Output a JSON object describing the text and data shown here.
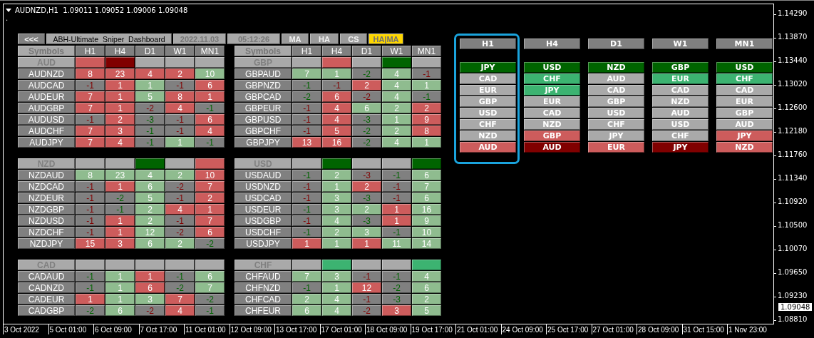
{
  "chart": {
    "title": "AUDNZD,H1  1.09011 1.09052 1.09006 1.09048",
    "subtitle": "."
  },
  "toolbar": {
    "back": "<<<",
    "title": "ABH-Ultimate  Sniper  Dashboard",
    "date": "2022.11.03",
    "time": "05:12:26",
    "tabs": [
      {
        "label": "MA",
        "selected": false
      },
      {
        "label": "HA",
        "selected": false
      },
      {
        "label": "CS",
        "selected": false
      },
      {
        "label": "HA|MA",
        "selected": true
      }
    ]
  },
  "tables": [
    {
      "symbol_header": "Symbols",
      "columns": [
        "H1",
        "H4",
        "D1",
        "W1",
        "MN1"
      ],
      "currency": "AUD",
      "signals": [
        {
          "color": "#cd5c5c"
        },
        {
          "color": "#800000"
        },
        {
          "color": "#a9a9a9"
        },
        {
          "color": "#a9a9a9"
        },
        {
          "color": "#a9a9a9"
        }
      ],
      "rows": [
        {
          "symbol": "AUDNZD",
          "cells": [
            {
              "text": "8",
              "color": "#cd5c5c"
            },
            {
              "text": "23",
              "color": "#cd5c5c"
            },
            {
              "text": "4",
              "color": "#cd5c5c"
            },
            {
              "text": "2",
              "color": "#cd5c5c"
            },
            {
              "text": "10",
              "color": "#8fbc8f"
            }
          ]
        },
        {
          "symbol": "AUDCAD",
          "cells": [
            {
              "text": "-1",
              "color": "#808080",
              "bullish": false
            },
            {
              "text": "1",
              "color": "#cd5c5c"
            },
            {
              "text": "1",
              "color": "#8fbc8f"
            },
            {
              "text": "-1",
              "color": "#808080",
              "bullish": false
            },
            {
              "text": "6",
              "color": "#cd5c5c"
            }
          ]
        },
        {
          "symbol": "AUDEUR",
          "cells": [
            {
              "text": "7",
              "color": "#cd5c5c"
            },
            {
              "text": "1",
              "color": "#cd5c5c"
            },
            {
              "text": "5",
              "color": "#8fbc8f"
            },
            {
              "text": "8",
              "color": "#cd5c5c"
            },
            {
              "text": "1",
              "color": "#cd5c5c"
            }
          ]
        },
        {
          "symbol": "AUDGBP",
          "cells": [
            {
              "text": "7",
              "color": "#cd5c5c"
            },
            {
              "text": "1",
              "color": "#cd5c5c"
            },
            {
              "text": "-2",
              "color": "#808080",
              "bullish": false
            },
            {
              "text": "4",
              "color": "#cd5c5c"
            },
            {
              "text": "-1",
              "color": "#808080",
              "bullish": true
            }
          ]
        },
        {
          "symbol": "AUDUSD",
          "cells": [
            {
              "text": "-1",
              "color": "#808080",
              "bullish": false
            },
            {
              "text": "2",
              "color": "#cd5c5c"
            },
            {
              "text": "-3",
              "color": "#808080",
              "bullish": true
            },
            {
              "text": "-1",
              "color": "#808080",
              "bullish": false
            },
            {
              "text": "6",
              "color": "#cd5c5c"
            }
          ]
        },
        {
          "symbol": "AUDCHF",
          "cells": [
            {
              "text": "7",
              "color": "#cd5c5c"
            },
            {
              "text": "3",
              "color": "#cd5c5c"
            },
            {
              "text": "-1",
              "color": "#808080",
              "bullish": true
            },
            {
              "text": "-1",
              "color": "#808080",
              "bullish": false
            },
            {
              "text": "4",
              "color": "#cd5c5c"
            }
          ]
        },
        {
          "symbol": "AUDJPY",
          "cells": [
            {
              "text": "7",
              "color": "#cd5c5c"
            },
            {
              "text": "4",
              "color": "#cd5c5c"
            },
            {
              "text": "-1",
              "color": "#808080",
              "bullish": true
            },
            {
              "text": "1",
              "color": "#8fbc8f"
            },
            {
              "text": "-1",
              "color": "#808080",
              "bullish": true
            }
          ]
        }
      ]
    },
    {
      "symbol_header": "Symbols",
      "columns": [
        "H1",
        "H4",
        "D1",
        "W1",
        "MN1"
      ],
      "currency": "GBP",
      "signals": [
        {
          "color": "#a9a9a9"
        },
        {
          "color": "#cd5c5c"
        },
        {
          "color": "#a9a9a9"
        },
        {
          "color": "#006400"
        },
        {
          "color": "#a9a9a9"
        }
      ],
      "rows": [
        {
          "symbol": "GBPAUD",
          "cells": [
            {
              "text": "7",
              "color": "#8fbc8f"
            },
            {
              "text": "1",
              "color": "#8fbc8f"
            },
            {
              "text": "-2",
              "color": "#808080",
              "bullish": true
            },
            {
              "text": "4",
              "color": "#8fbc8f"
            },
            {
              "text": "-1",
              "color": "#808080",
              "bullish": false
            }
          ]
        },
        {
          "symbol": "GBPNZD",
          "cells": [
            {
              "text": "-1",
              "color": "#808080",
              "bullish": true
            },
            {
              "text": "-1",
              "color": "#808080",
              "bullish": false
            },
            {
              "text": "2",
              "color": "#cd5c5c"
            },
            {
              "text": "4",
              "color": "#8fbc8f"
            },
            {
              "text": "1",
              "color": "#8fbc8f"
            }
          ]
        },
        {
          "symbol": "GBPCAD",
          "cells": [
            {
              "text": "-2",
              "color": "#808080",
              "bullish": true
            },
            {
              "text": "6",
              "color": "#cd5c5c"
            },
            {
              "text": "-2",
              "color": "#808080",
              "bullish": false
            },
            {
              "text": "4",
              "color": "#8fbc8f"
            },
            {
              "text": "-1",
              "color": "#808080",
              "bullish": true
            }
          ]
        },
        {
          "symbol": "GBPEUR",
          "cells": [
            {
              "text": "-1",
              "color": "#808080",
              "bullish": false
            },
            {
              "text": "4",
              "color": "#cd5c5c"
            },
            {
              "text": "6",
              "color": "#8fbc8f"
            },
            {
              "text": "2",
              "color": "#8fbc8f"
            },
            {
              "text": "2",
              "color": "#cd5c5c"
            }
          ]
        },
        {
          "symbol": "GBPUSD",
          "cells": [
            {
              "text": "-1",
              "color": "#808080",
              "bullish": false
            },
            {
              "text": "4",
              "color": "#cd5c5c"
            },
            {
              "text": "-3",
              "color": "#808080",
              "bullish": true
            },
            {
              "text": "1",
              "color": "#8fbc8f"
            },
            {
              "text": "9",
              "color": "#cd5c5c"
            }
          ]
        },
        {
          "symbol": "GBPCHF",
          "cells": [
            {
              "text": "-1",
              "color": "#808080",
              "bullish": false
            },
            {
              "text": "5",
              "color": "#cd5c5c"
            },
            {
              "text": "-2",
              "color": "#808080",
              "bullish": true
            },
            {
              "text": "2",
              "color": "#8fbc8f"
            },
            {
              "text": "8",
              "color": "#cd5c5c"
            }
          ]
        },
        {
          "symbol": "GBPJPY",
          "cells": [
            {
              "text": "13",
              "color": "#cd5c5c"
            },
            {
              "text": "16",
              "color": "#cd5c5c"
            },
            {
              "text": "-2",
              "color": "#808080",
              "bullish": true
            },
            {
              "text": "4",
              "color": "#8fbc8f"
            },
            {
              "text": "1",
              "color": "#8fbc8f"
            }
          ]
        }
      ]
    },
    {
      "currency": "NZD",
      "signals": [
        {
          "color": "#a9a9a9"
        },
        {
          "color": "#a9a9a9"
        },
        {
          "color": "#006400"
        },
        {
          "color": "#a9a9a9"
        },
        {
          "color": "#cd5c5c"
        }
      ],
      "rows": [
        {
          "symbol": "NZDAUD",
          "cells": [
            {
              "text": "8",
              "color": "#8fbc8f"
            },
            {
              "text": "23",
              "color": "#8fbc8f"
            },
            {
              "text": "4",
              "color": "#8fbc8f"
            },
            {
              "text": "2",
              "color": "#8fbc8f"
            },
            {
              "text": "10",
              "color": "#cd5c5c"
            }
          ]
        },
        {
          "symbol": "NZDCAD",
          "cells": [
            {
              "text": "-1",
              "color": "#808080",
              "bullish": false
            },
            {
              "text": "1",
              "color": "#cd5c5c"
            },
            {
              "text": "6",
              "color": "#8fbc8f"
            },
            {
              "text": "-2",
              "color": "#808080",
              "bullish": false
            },
            {
              "text": "7",
              "color": "#cd5c5c"
            }
          ]
        },
        {
          "symbol": "NZDEUR",
          "cells": [
            {
              "text": "-1",
              "color": "#808080",
              "bullish": false
            },
            {
              "text": "-2",
              "color": "#808080",
              "bullish": true
            },
            {
              "text": "5",
              "color": "#8fbc8f"
            },
            {
              "text": "-1",
              "color": "#808080",
              "bullish": false
            },
            {
              "text": "2",
              "color": "#cd5c5c"
            }
          ]
        },
        {
          "symbol": "NZDGBP",
          "cells": [
            {
              "text": "-1",
              "color": "#808080",
              "bullish": false
            },
            {
              "text": "-1",
              "color": "#808080",
              "bullish": true
            },
            {
              "text": "2",
              "color": "#8fbc8f"
            },
            {
              "text": "4",
              "color": "#cd5c5c"
            },
            {
              "text": "1",
              "color": "#cd5c5c"
            }
          ]
        },
        {
          "symbol": "NZDUSD",
          "cells": [
            {
              "text": "-1",
              "color": "#808080",
              "bullish": false
            },
            {
              "text": "1",
              "color": "#cd5c5c"
            },
            {
              "text": "2",
              "color": "#8fbc8f"
            },
            {
              "text": "-1",
              "color": "#808080",
              "bullish": false
            },
            {
              "text": "7",
              "color": "#cd5c5c"
            }
          ]
        },
        {
          "symbol": "NZDCHF",
          "cells": [
            {
              "text": "-1",
              "color": "#808080",
              "bullish": false
            },
            {
              "text": "1",
              "color": "#cd5c5c"
            },
            {
              "text": "12",
              "color": "#8fbc8f"
            },
            {
              "text": "-2",
              "color": "#808080",
              "bullish": false
            },
            {
              "text": "6",
              "color": "#cd5c5c"
            }
          ]
        },
        {
          "symbol": "NZDJPY",
          "cells": [
            {
              "text": "15",
              "color": "#cd5c5c"
            },
            {
              "text": "3",
              "color": "#cd5c5c"
            },
            {
              "text": "6",
              "color": "#8fbc8f"
            },
            {
              "text": "2",
              "color": "#8fbc8f"
            },
            {
              "text": "-2",
              "color": "#808080",
              "bullish": true
            }
          ]
        }
      ]
    },
    {
      "currency": "USD",
      "signals": [
        {
          "color": "#a9a9a9"
        },
        {
          "color": "#006400"
        },
        {
          "color": "#a9a9a9"
        },
        {
          "color": "#a9a9a9"
        },
        {
          "color": "#006400"
        }
      ],
      "rows": [
        {
          "symbol": "USDAUD",
          "cells": [
            {
              "text": "-1",
              "color": "#808080",
              "bullish": true
            },
            {
              "text": "2",
              "color": "#8fbc8f"
            },
            {
              "text": "-3",
              "color": "#808080",
              "bullish": false
            },
            {
              "text": "-1",
              "color": "#808080",
              "bullish": true
            },
            {
              "text": "6",
              "color": "#8fbc8f"
            }
          ]
        },
        {
          "symbol": "USDNZD",
          "cells": [
            {
              "text": "-1",
              "color": "#808080",
              "bullish": false
            },
            {
              "text": "1",
              "color": "#8fbc8f"
            },
            {
              "text": "2",
              "color": "#cd5c5c"
            },
            {
              "text": "-1",
              "color": "#808080",
              "bullish": false
            },
            {
              "text": "7",
              "color": "#8fbc8f"
            }
          ]
        },
        {
          "symbol": "USDCAD",
          "cells": [
            {
              "text": "-1",
              "color": "#808080",
              "bullish": false
            },
            {
              "text": "3",
              "color": "#8fbc8f"
            },
            {
              "text": "-3",
              "color": "#808080",
              "bullish": true
            },
            {
              "text": "-1",
              "color": "#808080",
              "bullish": false
            },
            {
              "text": "6",
              "color": "#8fbc8f"
            }
          ]
        },
        {
          "symbol": "USDEUR",
          "cells": [
            {
              "text": "-1",
              "color": "#808080",
              "bullish": true
            },
            {
              "text": "3",
              "color": "#8fbc8f"
            },
            {
              "text": "2",
              "color": "#8fbc8f"
            },
            {
              "text": "1",
              "color": "#cd5c5c"
            },
            {
              "text": "16",
              "color": "#8fbc8f"
            }
          ]
        },
        {
          "symbol": "USDGBP",
          "cells": [
            {
              "text": "-1",
              "color": "#808080",
              "bullish": false
            },
            {
              "text": "4",
              "color": "#8fbc8f"
            },
            {
              "text": "-3",
              "color": "#808080",
              "bullish": true
            },
            {
              "text": "1",
              "color": "#cd5c5c"
            },
            {
              "text": "9",
              "color": "#8fbc8f"
            }
          ]
        },
        {
          "symbol": "USDCHF",
          "cells": [
            {
              "text": "-1",
              "color": "#808080",
              "bullish": true
            },
            {
              "text": "2",
              "color": "#8fbc8f"
            },
            {
              "text": "3",
              "color": "#8fbc8f"
            },
            {
              "text": "-1",
              "color": "#808080",
              "bullish": true
            },
            {
              "text": "10",
              "color": "#8fbc8f"
            }
          ]
        },
        {
          "symbol": "USDJPY",
          "cells": [
            {
              "text": "1",
              "color": "#cd5c5c"
            },
            {
              "text": "1",
              "color": "#8fbc8f"
            },
            {
              "text": "1",
              "color": "#cd5c5c"
            },
            {
              "text": "11",
              "color": "#8fbc8f"
            },
            {
              "text": "14",
              "color": "#8fbc8f"
            }
          ]
        }
      ]
    },
    {
      "currency": "CAD",
      "signals": [
        {
          "color": "#a9a9a9"
        },
        {
          "color": "#a9a9a9"
        },
        {
          "color": "#a9a9a9"
        },
        {
          "color": "#a9a9a9"
        },
        {
          "color": "#a9a9a9"
        }
      ],
      "rows": [
        {
          "symbol": "CADAUD",
          "cells": [
            {
              "text": "-1",
              "color": "#808080",
              "bullish": true
            },
            {
              "text": "1",
              "color": "#8fbc8f"
            },
            {
              "text": "1",
              "color": "#cd5c5c"
            },
            {
              "text": "-1",
              "color": "#808080",
              "bullish": true
            },
            {
              "text": "6",
              "color": "#8fbc8f"
            }
          ]
        },
        {
          "symbol": "CADNZD",
          "cells": [
            {
              "text": "-1",
              "color": "#808080",
              "bullish": true
            },
            {
              "text": "1",
              "color": "#8fbc8f"
            },
            {
              "text": "6",
              "color": "#cd5c5c"
            },
            {
              "text": "-2",
              "color": "#808080",
              "bullish": true
            },
            {
              "text": "7",
              "color": "#8fbc8f"
            }
          ]
        },
        {
          "symbol": "CADEUR",
          "cells": [
            {
              "text": "1",
              "color": "#cd5c5c"
            },
            {
              "text": "1",
              "color": "#8fbc8f"
            },
            {
              "text": "3",
              "color": "#8fbc8f"
            },
            {
              "text": "7",
              "color": "#cd5c5c"
            },
            {
              "text": "-2",
              "color": "#808080",
              "bullish": true
            }
          ]
        },
        {
          "symbol": "CADGBP",
          "cells": [
            {
              "text": "-2",
              "color": "#808080",
              "bullish": true
            },
            {
              "text": "6",
              "color": "#8fbc8f"
            },
            {
              "text": "-2",
              "color": "#808080",
              "bullish": false
            },
            {
              "text": "4",
              "color": "#cd5c5c"
            },
            {
              "text": "-1",
              "color": "#808080",
              "bullish": true
            }
          ]
        }
      ]
    },
    {
      "currency": "CHF",
      "signals": [
        {
          "color": "#a9a9a9"
        },
        {
          "color": "#3cb371"
        },
        {
          "color": "#a9a9a9"
        },
        {
          "color": "#a9a9a9"
        },
        {
          "color": "#3cb371"
        }
      ],
      "rows": [
        {
          "symbol": "CHFAUD",
          "cells": [
            {
              "text": "7",
              "color": "#8fbc8f"
            },
            {
              "text": "3",
              "color": "#8fbc8f"
            },
            {
              "text": "-1",
              "color": "#808080",
              "bullish": false
            },
            {
              "text": "-1",
              "color": "#808080",
              "bullish": true
            },
            {
              "text": "4",
              "color": "#8fbc8f"
            }
          ]
        },
        {
          "symbol": "CHFNZD",
          "cells": [
            {
              "text": "-1",
              "color": "#808080",
              "bullish": true
            },
            {
              "text": "1",
              "color": "#8fbc8f"
            },
            {
              "text": "12",
              "color": "#cd5c5c"
            },
            {
              "text": "-2",
              "color": "#808080",
              "bullish": true
            },
            {
              "text": "6",
              "color": "#8fbc8f"
            }
          ]
        },
        {
          "symbol": "CHFCAD",
          "cells": [
            {
              "text": "2",
              "color": "#8fbc8f"
            },
            {
              "text": "4",
              "color": "#8fbc8f"
            },
            {
              "text": "-1",
              "color": "#808080",
              "bullish": false
            },
            {
              "text": "-3",
              "color": "#808080",
              "bullish": true
            },
            {
              "text": "2",
              "color": "#8fbc8f"
            }
          ]
        },
        {
          "symbol": "CHFEUR",
          "cells": [
            {
              "text": "6",
              "color": "#8fbc8f"
            },
            {
              "text": "4",
              "color": "#8fbc8f"
            },
            {
              "text": "-2",
              "color": "#808080",
              "bullish": false
            },
            {
              "text": "3",
              "color": "#cd5c5c"
            },
            {
              "text": "5",
              "color": "#8fbc8f"
            }
          ]
        }
      ]
    }
  ],
  "strength": [
    {
      "label": "H1",
      "highlighted": true,
      "items": [
        {
          "text": "JPY",
          "color": "#006400"
        },
        {
          "text": "CAD",
          "color": "#a9a9a9"
        },
        {
          "text": "EUR",
          "color": "#a9a9a9"
        },
        {
          "text": "GBP",
          "color": "#a9a9a9"
        },
        {
          "text": "USD",
          "color": "#a9a9a9"
        },
        {
          "text": "CHF",
          "color": "#a9a9a9"
        },
        {
          "text": "NZD",
          "color": "#a9a9a9"
        },
        {
          "text": "AUD",
          "color": "#cd5c5c"
        }
      ]
    },
    {
      "label": "H4",
      "highlighted": false,
      "items": [
        {
          "text": "USD",
          "color": "#006400"
        },
        {
          "text": "CHF",
          "color": "#3cb371"
        },
        {
          "text": "JPY",
          "color": "#3cb371"
        },
        {
          "text": "EUR",
          "color": "#a9a9a9"
        },
        {
          "text": "CAD",
          "color": "#a9a9a9"
        },
        {
          "text": "NZD",
          "color": "#a9a9a9"
        },
        {
          "text": "GBP",
          "color": "#cd5c5c"
        },
        {
          "text": "AUD",
          "color": "#800000"
        }
      ]
    },
    {
      "label": "D1",
      "highlighted": false,
      "items": [
        {
          "text": "NZD",
          "color": "#006400"
        },
        {
          "text": "AUD",
          "color": "#a9a9a9"
        },
        {
          "text": "CAD",
          "color": "#a9a9a9"
        },
        {
          "text": "GBP",
          "color": "#a9a9a9"
        },
        {
          "text": "USD",
          "color": "#a9a9a9"
        },
        {
          "text": "CHF",
          "color": "#a9a9a9"
        },
        {
          "text": "JPY",
          "color": "#a9a9a9"
        },
        {
          "text": "EUR",
          "color": "#cd5c5c"
        }
      ]
    },
    {
      "label": "W1",
      "highlighted": false,
      "items": [
        {
          "text": "GBP",
          "color": "#006400"
        },
        {
          "text": "EUR",
          "color": "#3cb371"
        },
        {
          "text": "CAD",
          "color": "#a9a9a9"
        },
        {
          "text": "NZD",
          "color": "#a9a9a9"
        },
        {
          "text": "AUD",
          "color": "#a9a9a9"
        },
        {
          "text": "USD",
          "color": "#a9a9a9"
        },
        {
          "text": "CHF",
          "color": "#a9a9a9"
        },
        {
          "text": "JPY",
          "color": "#800000"
        }
      ]
    },
    {
      "label": "MN1",
      "highlighted": false,
      "items": [
        {
          "text": "USD",
          "color": "#006400"
        },
        {
          "text": "CHF",
          "color": "#3cb371"
        },
        {
          "text": "CAD",
          "color": "#a9a9a9"
        },
        {
          "text": "EUR",
          "color": "#a9a9a9"
        },
        {
          "text": "GBP",
          "color": "#a9a9a9"
        },
        {
          "text": "AUD",
          "color": "#a9a9a9"
        },
        {
          "text": "JPY",
          "color": "#cd5c5c"
        },
        {
          "text": "NZD",
          "color": "#cd5c5c"
        }
      ]
    }
  ],
  "price_axis": {
    "ticks": [
      "1.14290",
      "1.13870",
      "1.13440",
      "1.13020",
      "1.12600",
      "1.12180",
      "1.11760",
      "1.11340",
      "1.10920",
      "1.10500",
      "1.10070",
      "1.09650",
      "1.09230",
      "1.08810"
    ],
    "current": "1.09048"
  },
  "time_axis": [
    "3 Oct 2022",
    "5 Oct 01:00",
    "6 Oct 09:00",
    "7 Oct 17:00",
    "11 Oct 01:00",
    "12 Oct 09:00",
    "13 Oct 17:00",
    "17 Oct 01:00",
    "18 Oct 09:00",
    "19 Oct 17:00",
    "21 Oct 01:00",
    "24 Oct 09:00",
    "25 Oct 17:00",
    "27 Oct 01:00",
    "28 Oct 09:00",
    "31 Oct 15:00",
    "1 Nov 23:00"
  ]
}
